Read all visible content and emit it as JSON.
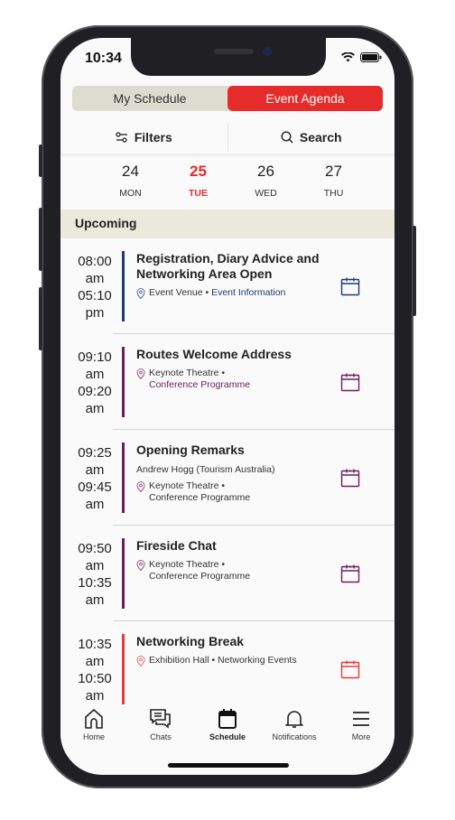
{
  "status": {
    "time": "10:34"
  },
  "segments": [
    {
      "label": "My Schedule",
      "active": false
    },
    {
      "label": "Event Agenda",
      "active": true
    }
  ],
  "toolbar": {
    "filters": "Filters",
    "search": "Search"
  },
  "dates": [
    {
      "num": "24",
      "day": "MON"
    },
    {
      "num": "25",
      "day": "TUE",
      "selected": true
    },
    {
      "num": "26",
      "day": "WED"
    },
    {
      "num": "27",
      "day": "THU"
    }
  ],
  "section": "Upcoming",
  "events": [
    {
      "start": "08:00",
      "start_ampm": "am",
      "end": "05:10",
      "end_ampm": "pm",
      "title": "Registration, Diary Advice and Networking Area Open",
      "speaker": "",
      "venue": "Event Venue •",
      "track": "Event Information",
      "color": "#1e3a6e"
    },
    {
      "start": "09:10",
      "start_ampm": "am",
      "end": "09:20",
      "end_ampm": "am",
      "title": "Routes Welcome Address",
      "speaker": "",
      "venue": "Keynote Theatre •",
      "track": "Conference Programme",
      "color": "#6b1f5a"
    },
    {
      "start": "09:25",
      "start_ampm": "am",
      "end": "09:45",
      "end_ampm": "am",
      "title": "Opening Remarks",
      "speaker": "Andrew Hogg (Tourism Australia)",
      "venue": "Keynote Theatre •",
      "track": "Conference Programme",
      "color": "#6b1f5a",
      "track_color": "#333333"
    },
    {
      "start": "09:50",
      "start_ampm": "am",
      "end": "10:35",
      "end_ampm": "am",
      "title": "Fireside Chat",
      "speaker": "",
      "venue": "Keynote Theatre •",
      "track": "Conference Programme",
      "color": "#6b1f5a",
      "track_color": "#333333"
    },
    {
      "start": "10:35",
      "start_ampm": "am",
      "end": "10:50",
      "end_ampm": "am",
      "title": "Networking Break",
      "speaker": "",
      "venue": "Exhibition Hall • Networking Events",
      "track": "",
      "color": "#e63b3b"
    }
  ],
  "tabs": [
    {
      "label": "Home",
      "icon": "home-icon"
    },
    {
      "label": "Chats",
      "icon": "chat-icon"
    },
    {
      "label": "Schedule",
      "icon": "calendar-icon",
      "active": true
    },
    {
      "label": "Notifications",
      "icon": "bell-icon"
    },
    {
      "label": "More",
      "icon": "menu-icon"
    }
  ],
  "colors": {
    "accent": "#e62b2b",
    "section_bg": "#eae9dc"
  }
}
